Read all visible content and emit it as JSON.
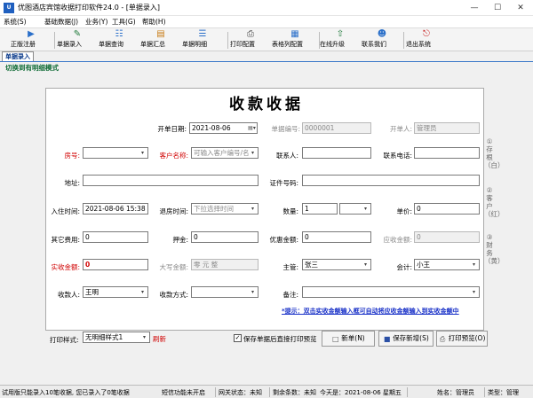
{
  "window": {
    "title": "优图酒店宾馆收据打印软件24.0 - [单据录入]",
    "app_icon": "U"
  },
  "menu": [
    {
      "label": "系统(S)"
    },
    {
      "label": "基础数据(J)"
    },
    {
      "label": "业务(Y)"
    },
    {
      "label": "工具(G)"
    },
    {
      "label": "帮助(H)"
    }
  ],
  "toolbar": [
    {
      "label": "正版注册",
      "icon": "register-icon"
    },
    {
      "label": "单据录入",
      "icon": "receipt-entry-icon"
    },
    {
      "label": "单据查询",
      "icon": "receipt-query-icon"
    },
    {
      "label": "单据汇总",
      "icon": "receipt-summary-icon"
    },
    {
      "label": "单据明细",
      "icon": "receipt-detail-icon"
    },
    {
      "label": "打印配置",
      "icon": "print-config-icon"
    },
    {
      "label": "表格列配置",
      "icon": "table-column-icon"
    },
    {
      "label": "在线升级",
      "icon": "upgrade-icon"
    },
    {
      "label": "联系我们",
      "icon": "contact-icon"
    },
    {
      "label": "退出系统",
      "icon": "exit-icon"
    }
  ],
  "tab": {
    "label": "单据录入"
  },
  "switch_link": "切换到有明细模式",
  "form": {
    "title": "收款收据",
    "open_date": {
      "label": "开单日期:",
      "value": "2021-08-06"
    },
    "receipt_no": {
      "label": "单据编号:",
      "value": "0000001"
    },
    "operator": {
      "label": "开单人:",
      "value": "管理员"
    },
    "room_no": {
      "label": "房号:",
      "value": ""
    },
    "customer_name": {
      "label": "客户名称:",
      "placeholder": "可输入客户编号/名"
    },
    "contact": {
      "label": "联系人:",
      "value": ""
    },
    "phone": {
      "label": "联系电话:",
      "value": ""
    },
    "address": {
      "label": "地址:",
      "value": ""
    },
    "id_no": {
      "label": "证件号码:",
      "value": ""
    },
    "checkin_time": {
      "label": "入住时间:",
      "value": "2021-08-06 15:38"
    },
    "checkout_time": {
      "label": "退房时间:",
      "placeholder": "下拉选择时间"
    },
    "quantity": {
      "label": "数量:",
      "value": "1"
    },
    "unit_price": {
      "label": "单价:",
      "value": "0"
    },
    "other_fee": {
      "label": "其它费用:",
      "value": "0"
    },
    "deposit": {
      "label": "押金:",
      "value": "0"
    },
    "discount": {
      "label": "优惠金额:",
      "value": "0"
    },
    "receivable": {
      "label": "应收金额:",
      "value": "0"
    },
    "received": {
      "label": "实收金额:",
      "value": "0"
    },
    "amount_upper": {
      "label": "大写金额:",
      "value": "零 元 整"
    },
    "manager": {
      "label": "主管:",
      "value": "张三"
    },
    "accountant": {
      "label": "会计:",
      "value": "小王"
    },
    "payee": {
      "label": "收款人:",
      "value": "王明"
    },
    "pay_method": {
      "label": "收款方式:",
      "value": ""
    },
    "remark": {
      "label": "备注:",
      "value": ""
    },
    "tip": "*提示：双击实收金额输入框可自动将应收金额输入到实收金额中"
  },
  "side_labels": [
    "①存根（白）",
    "②客户（红）",
    "③财务（黄）"
  ],
  "bottom": {
    "print_style_label": "打印样式:",
    "print_style_value": "无明细样式1",
    "refresh_label": "刷新",
    "preview_check_label": "保存单据后直接打印预览",
    "preview_checked": true,
    "new_button": "新单(N)",
    "save_new_button": "保存新增(S)",
    "print_preview_button": "打印预览(O)"
  },
  "status": {
    "trial": "试用版只能录入10笔收据, 您已录入了0笔收据",
    "sms": "短信功能未开启",
    "network": "网关状态：未知",
    "sms_left": "剩余条数：未知",
    "today": "今天是：2021-08-06 星期五",
    "name": "姓名：管理员",
    "type": "类型：管理"
  },
  "colors": {
    "required_label": "#d00000",
    "tip_link": "#1a32c8",
    "switch_link": "#0f6b35"
  }
}
